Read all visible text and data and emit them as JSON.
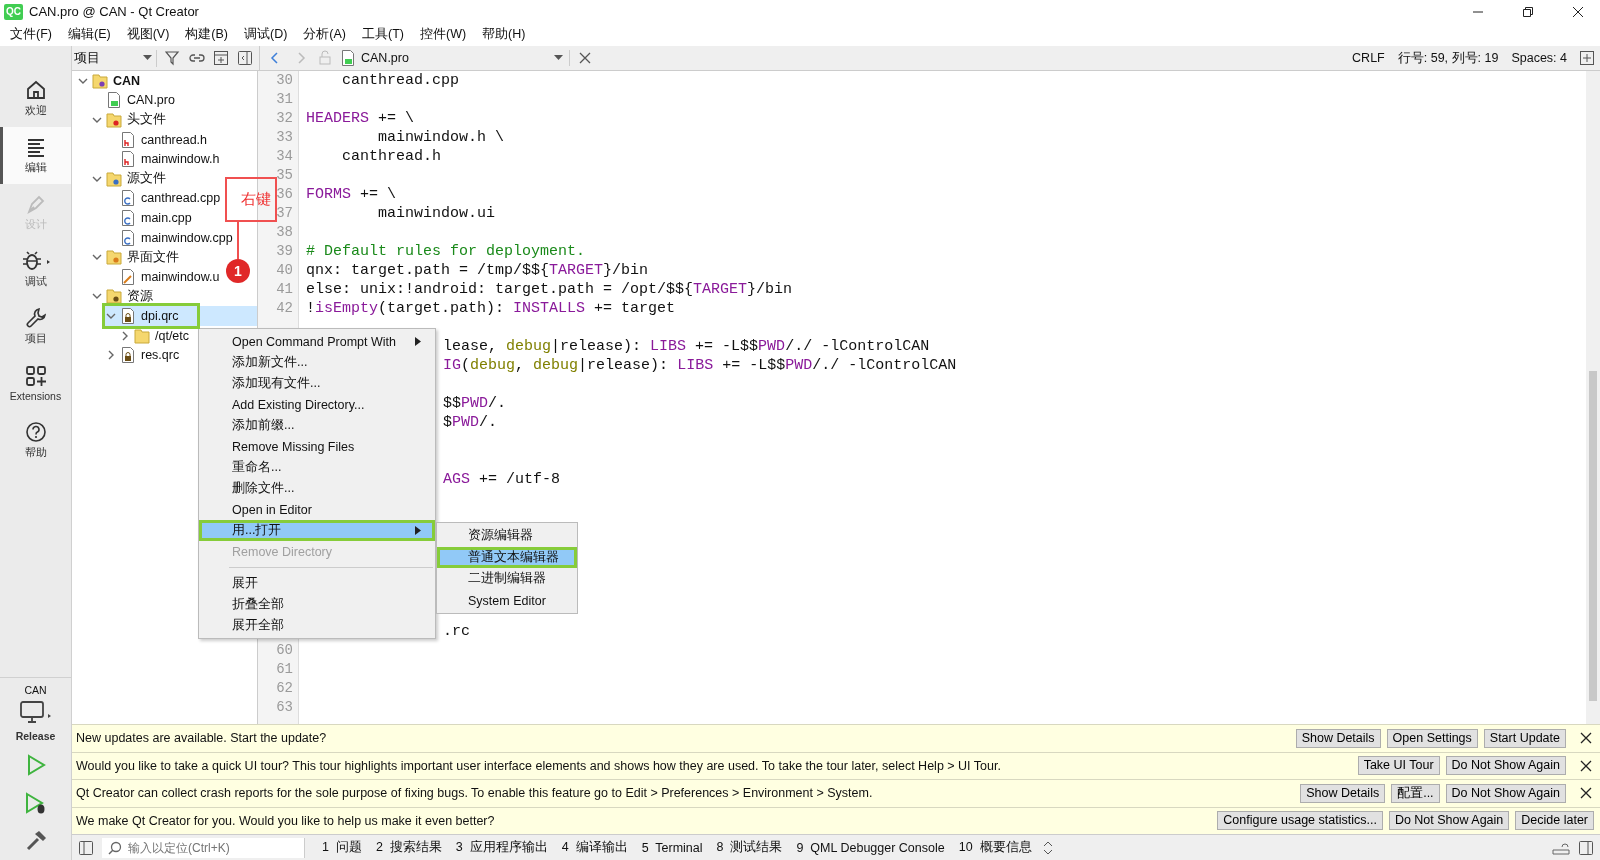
{
  "window": {
    "logo": "QC",
    "title": "CAN.pro @ CAN - Qt Creator"
  },
  "menu": [
    "文件(F)",
    "编辑(E)",
    "视图(V)",
    "构建(B)",
    "调试(D)",
    "分析(A)",
    "工具(T)",
    "控件(W)",
    "帮助(H)"
  ],
  "mode_bar": {
    "modes": [
      {
        "label": "欢迎",
        "kind": "home",
        "selected": false,
        "disabled": false
      },
      {
        "label": "编辑",
        "kind": "edit",
        "selected": true,
        "disabled": false
      },
      {
        "label": "设计",
        "kind": "design",
        "selected": false,
        "disabled": true
      },
      {
        "label": "调试",
        "kind": "debug",
        "selected": false,
        "disabled": false
      },
      {
        "label": "项目",
        "kind": "projects",
        "selected": false,
        "disabled": false
      },
      {
        "label": "Extensions",
        "kind": "extensions",
        "selected": false,
        "disabled": false
      },
      {
        "label": "帮助",
        "kind": "help",
        "selected": false,
        "disabled": false
      }
    ],
    "target": {
      "project": "CAN",
      "config": "Release"
    }
  },
  "project_panel": {
    "view": "项目",
    "tree": [
      {
        "label": "CAN",
        "kind": "project",
        "expanded": true,
        "selected": false,
        "outlined": false,
        "children": [
          {
            "label": "CAN.pro",
            "kind": "pro",
            "selected": false,
            "outlined": false
          },
          {
            "label": "头文件",
            "kind": "header-folder",
            "expanded": true,
            "selected": false,
            "outlined": false,
            "children": [
              {
                "label": "canthread.h",
                "kind": "header",
                "selected": false,
                "outlined": false
              },
              {
                "label": "mainwindow.h",
                "kind": "header",
                "selected": false,
                "outlined": false
              }
            ]
          },
          {
            "label": "源文件",
            "kind": "source-folder",
            "expanded": true,
            "selected": false,
            "outlined": false,
            "children": [
              {
                "label": "canthread.cpp",
                "kind": "source",
                "selected": false,
                "outlined": false
              },
              {
                "label": "main.cpp",
                "kind": "source",
                "selected": false,
                "outlined": false
              },
              {
                "label": "mainwindow.cpp",
                "kind": "source",
                "selected": false,
                "outlined": false
              }
            ]
          },
          {
            "label": "界面文件",
            "kind": "form-folder",
            "expanded": true,
            "selected": false,
            "outlined": false,
            "children": [
              {
                "label": "mainwindow.u",
                "kind": "form",
                "selected": false,
                "outlined": false
              }
            ]
          },
          {
            "label": "资源",
            "kind": "resource-folder",
            "expanded": true,
            "selected": false,
            "outlined": false,
            "children": [
              {
                "label": "dpi.qrc",
                "kind": "qrc",
                "expanded": true,
                "selected": true,
                "outlined": true,
                "children": [
                  {
                    "label": "/qt/etc",
                    "kind": "folder",
                    "expanded": false,
                    "selected": false,
                    "outlined": false
                  }
                ]
              },
              {
                "label": "res.qrc",
                "kind": "qrc",
                "expanded": false,
                "selected": false,
                "outlined": false
              }
            ]
          }
        ]
      }
    ]
  },
  "editor": {
    "file": "CAN.pro",
    "line_ending": "CRLF",
    "position": "行号: 59, 列号: 19",
    "indent": "Spaces: 4",
    "lines": [
      {
        "kind": "code",
        "number": "30",
        "segments": [
          {
            "text": "    canthread.cpp",
            "kind": "plain"
          }
        ]
      },
      {
        "kind": "code",
        "number": "31"
      },
      {
        "kind": "code",
        "number": "32",
        "segments": [
          {
            "text": "HEADERS",
            "kind": "variable"
          },
          {
            "text": " += \\",
            "kind": "plain"
          }
        ]
      },
      {
        "kind": "code",
        "number": "33",
        "segments": [
          {
            "text": "        mainwindow.h \\",
            "kind": "plain"
          }
        ]
      },
      {
        "kind": "code",
        "number": "34",
        "segments": [
          {
            "text": "    canthread.h",
            "kind": "plain"
          }
        ]
      },
      {
        "kind": "code",
        "number": "35"
      },
      {
        "kind": "code",
        "number": "36",
        "segments": [
          {
            "text": "FORMS",
            "kind": "variable"
          },
          {
            "text": " += \\",
            "kind": "plain"
          }
        ]
      },
      {
        "kind": "code",
        "number": "37",
        "segments": [
          {
            "text": "        mainwindow.ui",
            "kind": "plain"
          }
        ]
      },
      {
        "kind": "code",
        "number": "38"
      },
      {
        "kind": "code",
        "number": "39",
        "segments": [
          {
            "text": "# Default rules for deployment.",
            "kind": "comment"
          }
        ]
      },
      {
        "kind": "code",
        "number": "40",
        "segments": [
          {
            "text": "qnx: target.path = /tmp/$${",
            "kind": "plain"
          },
          {
            "text": "TARGET",
            "kind": "variable"
          },
          {
            "text": "}/bin",
            "kind": "plain"
          }
        ]
      },
      {
        "kind": "code",
        "number": "41",
        "segments": [
          {
            "text": "else: unix:!android: target.path = /opt/$${",
            "kind": "plain"
          },
          {
            "text": "TARGET",
            "kind": "variable"
          },
          {
            "text": "}/bin",
            "kind": "plain"
          }
        ]
      },
      {
        "kind": "code",
        "number": "42",
        "segments": [
          {
            "text": "!",
            "kind": "plain"
          },
          {
            "text": "isEmpty",
            "kind": "variable"
          },
          {
            "text": "(target.path): ",
            "kind": "plain"
          },
          {
            "text": "INSTALLS",
            "kind": "variable"
          },
          {
            "text": " += target",
            "kind": "plain"
          }
        ]
      },
      {
        "kind": "hidden"
      },
      {
        "kind": "covered",
        "segments": [
          {
            "text": "lease, ",
            "kind": "plain"
          },
          {
            "text": "debug",
            "kind": "builtin"
          },
          {
            "text": "|release): ",
            "kind": "plain"
          },
          {
            "text": "LIBS",
            "kind": "variable"
          },
          {
            "text": " += -L$$",
            "kind": "plain"
          },
          {
            "text": "PWD",
            "kind": "variable"
          },
          {
            "text": "/./ -lControlCAN",
            "kind": "plain"
          }
        ]
      },
      {
        "kind": "covered",
        "segments": [
          {
            "text": "IG",
            "kind": "variable"
          },
          {
            "text": "(",
            "kind": "plain"
          },
          {
            "text": "debug",
            "kind": "builtin"
          },
          {
            "text": ", ",
            "kind": "plain"
          },
          {
            "text": "debug",
            "kind": "builtin"
          },
          {
            "text": "|release): ",
            "kind": "plain"
          },
          {
            "text": "LIBS",
            "kind": "variable"
          },
          {
            "text": " += -L$$",
            "kind": "plain"
          },
          {
            "text": "PWD",
            "kind": "variable"
          },
          {
            "text": "/./ -lControlCAN",
            "kind": "plain"
          }
        ]
      },
      {
        "kind": "hidden"
      },
      {
        "kind": "covered",
        "segments": [
          {
            "text": "$$",
            "kind": "plain"
          },
          {
            "text": "PWD",
            "kind": "variable"
          },
          {
            "text": "/.",
            "kind": "plain"
          }
        ]
      },
      {
        "kind": "covered",
        "segments": [
          {
            "text": "$",
            "kind": "plain"
          },
          {
            "text": "PWD",
            "kind": "variable"
          },
          {
            "text": "/.",
            "kind": "plain"
          }
        ]
      },
      {
        "kind": "hidden"
      },
      {
        "kind": "hidden"
      },
      {
        "kind": "covered",
        "segments": [
          {
            "text": "AGS",
            "kind": "variable"
          },
          {
            "text": " += /utf-8",
            "kind": "plain"
          }
        ]
      },
      {
        "kind": "hidden"
      },
      {
        "kind": "hidden"
      },
      {
        "kind": "hidden"
      },
      {
        "kind": "hidden"
      },
      {
        "kind": "hidden"
      },
      {
        "kind": "hidden"
      },
      {
        "kind": "hidden"
      },
      {
        "kind": "covered",
        "segments": [
          {
            "text": ".rc",
            "kind": "plain"
          }
        ]
      },
      {
        "kind": "code",
        "number": "60"
      },
      {
        "kind": "code",
        "number": "61"
      },
      {
        "kind": "code",
        "number": "62"
      },
      {
        "kind": "code",
        "number": "63"
      }
    ]
  },
  "context_menu": {
    "items": [
      {
        "kind": "item",
        "label": "Open Command Prompt With",
        "submenu": true,
        "selected": false,
        "disabled": false,
        "outlined": false
      },
      {
        "kind": "item",
        "label": "添加新文件...",
        "submenu": false,
        "selected": false,
        "disabled": false,
        "outlined": false
      },
      {
        "kind": "item",
        "label": "添加现有文件...",
        "submenu": false,
        "selected": false,
        "disabled": false,
        "outlined": false
      },
      {
        "kind": "item",
        "label": "Add Existing Directory...",
        "submenu": false,
        "selected": false,
        "disabled": false,
        "outlined": false
      },
      {
        "kind": "item",
        "label": "添加前缀...",
        "submenu": false,
        "selected": false,
        "disabled": false,
        "outlined": false
      },
      {
        "kind": "item",
        "label": "Remove Missing Files",
        "submenu": false,
        "selected": false,
        "disabled": false,
        "outlined": false
      },
      {
        "kind": "item",
        "label": "重命名...",
        "submenu": false,
        "selected": false,
        "disabled": false,
        "outlined": false
      },
      {
        "kind": "item",
        "label": "删除文件...",
        "submenu": false,
        "selected": false,
        "disabled": false,
        "outlined": false
      },
      {
        "kind": "item",
        "label": "Open in Editor",
        "submenu": false,
        "selected": false,
        "disabled": false,
        "outlined": false
      },
      {
        "kind": "item",
        "label": "用...打开",
        "submenu": true,
        "selected": true,
        "disabled": false,
        "outlined": true
      },
      {
        "kind": "item",
        "label": "Remove Directory",
        "submenu": false,
        "selected": false,
        "disabled": true,
        "outlined": false
      },
      {
        "kind": "separator"
      },
      {
        "kind": "item",
        "label": "展开",
        "submenu": false,
        "selected": false,
        "disabled": false,
        "outlined": false
      },
      {
        "kind": "item",
        "label": "折叠全部",
        "submenu": false,
        "selected": false,
        "disabled": false,
        "outlined": false
      },
      {
        "kind": "item",
        "label": "展开全部",
        "submenu": false,
        "selected": false,
        "disabled": false,
        "outlined": false
      }
    ]
  },
  "submenu": {
    "items": [
      {
        "label": "资源编辑器",
        "selected": false,
        "outlined": false
      },
      {
        "label": "普通文本编辑器",
        "selected": true,
        "outlined": true
      },
      {
        "label": "二进制编辑器",
        "selected": false,
        "outlined": false
      },
      {
        "label": "System Editor",
        "selected": false,
        "outlined": false
      }
    ]
  },
  "annotations": [
    {
      "kind": "callout",
      "text": "右键"
    },
    {
      "kind": "step",
      "text": "1"
    }
  ],
  "info_bars": [
    {
      "text": "New updates are available. Start the update?",
      "buttons": [
        "Show Details",
        "Open Settings",
        "Start Update"
      ],
      "closable": true
    },
    {
      "text": "Would you like to take a quick UI tour? This tour highlights important user interface elements and shows how they are used. To take the tour later, select Help > UI Tour.",
      "buttons": [
        "Take UI Tour",
        "Do Not Show Again"
      ],
      "closable": true
    },
    {
      "text": "Qt Creator can collect crash reports for the sole purpose of fixing bugs. To enable this feature go to Edit > Preferences > Environment > System.",
      "buttons": [
        "Show Details",
        "配置...",
        "Do Not Show Again"
      ],
      "closable": true
    },
    {
      "text": "We make Qt Creator for you. Would you like to help us make it even better?",
      "buttons": [
        "Configure usage statistics...",
        "Do Not Show Again",
        "Decide later"
      ],
      "closable": false
    }
  ],
  "status_bar": {
    "locator_placeholder": "输入以定位(Ctrl+K)",
    "panes": [
      "1  问题",
      "2  搜索结果",
      "3  应用程序输出",
      "4  编译输出",
      "5  Terminal",
      "8  测试结果",
      "9  QML Debugger Console",
      "10  概要信息"
    ]
  }
}
